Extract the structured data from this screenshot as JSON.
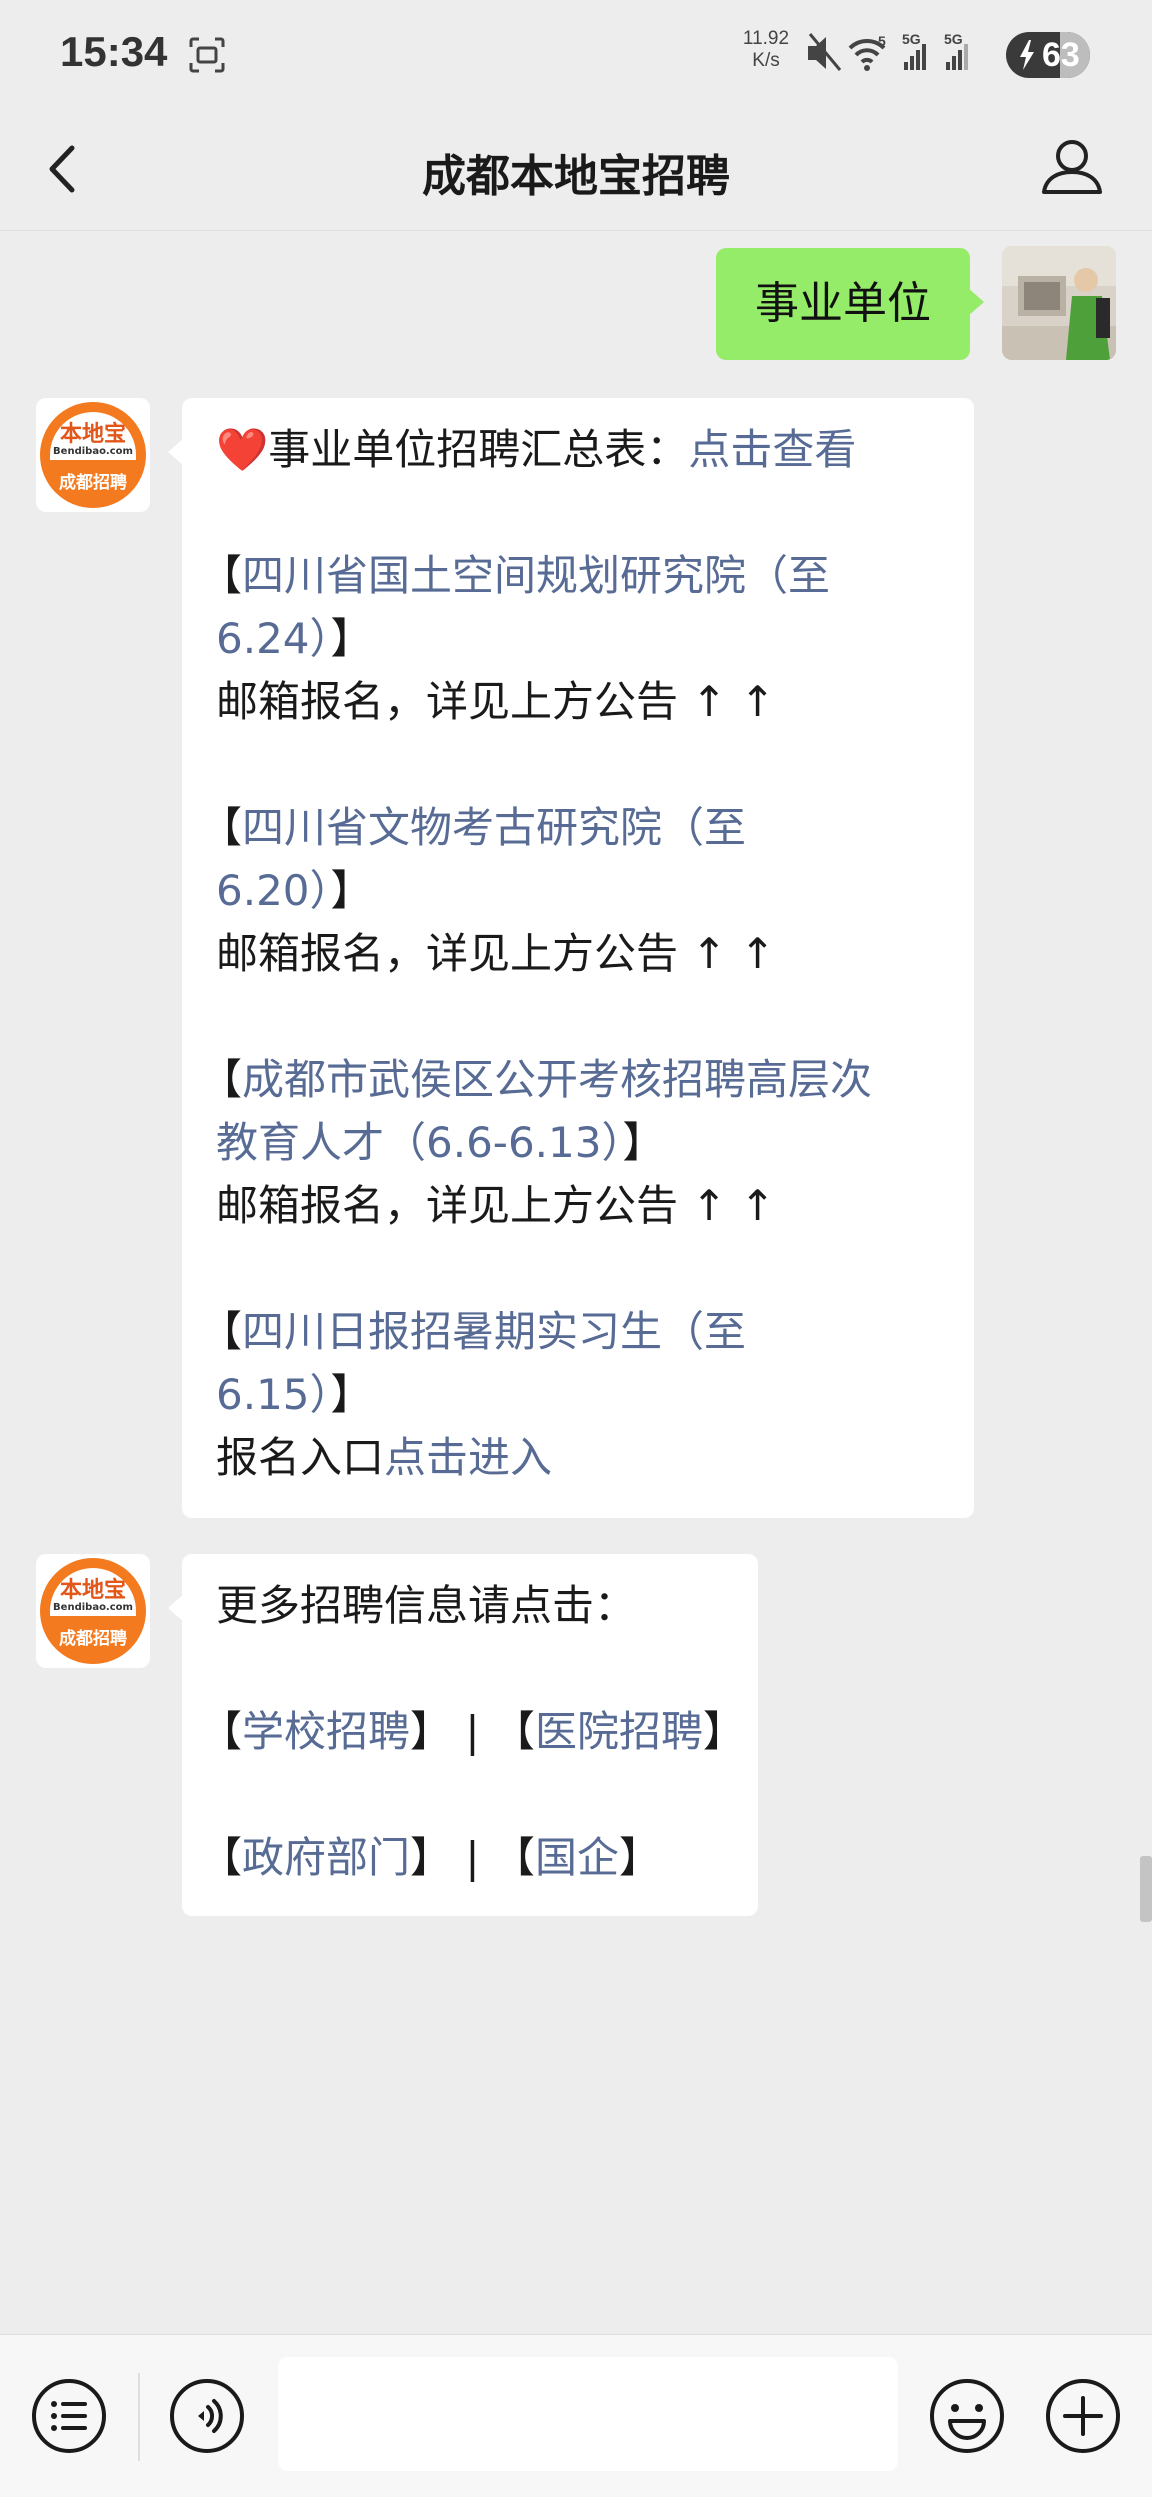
{
  "status_bar": {
    "time": "15:34",
    "net_speed_value": "11.92",
    "net_speed_unit": "K/s",
    "wifi_badge": "5",
    "signal1_label": "5G",
    "signal2_label": "5G",
    "battery_level": "63"
  },
  "nav": {
    "title": "成都本地宝招聘"
  },
  "outgoing_message": {
    "text": "事业单位"
  },
  "bot": {
    "avatar_brand": "本地宝",
    "avatar_domain": "Bendibao.com",
    "avatar_sub": "成都招聘"
  },
  "message1": {
    "heart": "❤️",
    "summary_label": "事业单位招聘汇总表：",
    "summary_link": "点击查看",
    "jobs": [
      {
        "open": "【",
        "title_line1": "四川省国土空间规划研究院（至",
        "title_line2": "6.24）",
        "close": "】",
        "note": "邮箱报名，详见上方公告 ↑ ↑"
      },
      {
        "open": "【",
        "title_line1": "四川省文物考古研究院（至",
        "title_line2": "6.20）",
        "close": "】",
        "note": "邮箱报名，详见上方公告 ↑ ↑"
      },
      {
        "open": "【",
        "title_line1": "成都市武侯区公开考核招聘高层次",
        "title_line2": "教育人才（6.6-6.13）",
        "close": "】",
        "note": "邮箱报名，详见上方公告 ↑ ↑"
      },
      {
        "open": "【",
        "title_line1": "四川日报招暑期实习生（至",
        "title_line2": "6.15）",
        "close": "】",
        "note_prefix": "报名入口",
        "note_link": "点击进入"
      }
    ]
  },
  "message2": {
    "intro": "更多招聘信息请点击：",
    "open": "【",
    "close": "】",
    "divider": "|",
    "links": [
      "学校招聘",
      "医院招聘",
      "政府部门",
      "国企"
    ]
  },
  "input": {
    "placeholder": ""
  },
  "colors": {
    "outgoing_bubble": "#95ec69",
    "link": "#576b95",
    "background": "#ededed",
    "brand_orange": "#f37a1f"
  }
}
